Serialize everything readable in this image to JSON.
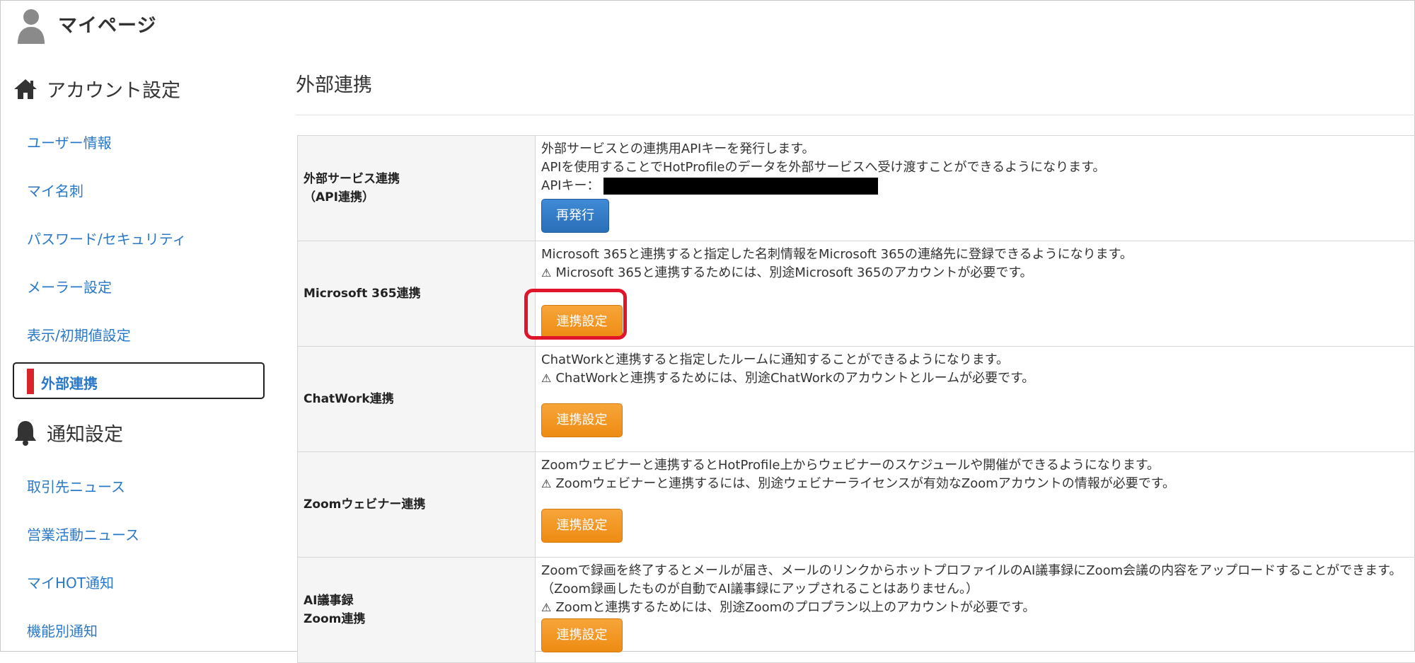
{
  "header": {
    "title": "マイページ",
    "icon": "user-icon"
  },
  "sidebar": {
    "account_section": {
      "label": "アカウント設定",
      "icon": "home-icon"
    },
    "account_items": [
      {
        "label": "ユーザー情報"
      },
      {
        "label": "マイ名刺"
      },
      {
        "label": "パスワード/セキュリティ"
      },
      {
        "label": "メーラー設定"
      },
      {
        "label": "表示/初期値設定"
      },
      {
        "label": "外部連携",
        "active": true
      }
    ],
    "notify_section": {
      "label": "通知設定",
      "icon": "bell-icon"
    },
    "notify_items": [
      {
        "label": "取引先ニュース"
      },
      {
        "label": "営業活動ニュース"
      },
      {
        "label": "マイHOT通知"
      },
      {
        "label": "機能別通知"
      }
    ]
  },
  "main": {
    "title": "外部連携",
    "rows": [
      {
        "label_line1": "外部サービス連携",
        "label_line2": "（API連携）",
        "desc1": "外部サービスとの連携用APIキーを発行します。",
        "desc2": "APIを使用することでHotProfileのデータを外部サービスへ受け渡すことができるようになります。",
        "api_key_label": "APIキー：",
        "button": "再発行"
      },
      {
        "label_line1": "Microsoft 365連携",
        "desc1": "Microsoft 365と連携すると指定した名刺情報をMicrosoft 365の連絡先に登録できるようになります。",
        "warning": "Microsoft 365と連携するためには、別途Microsoft 365のアカウントが必要です。",
        "button": "連携設定"
      },
      {
        "label_line1": "ChatWork連携",
        "desc1": "ChatWorkと連携すると指定したルームに通知することができるようになります。",
        "warning": "ChatWorkと連携するためには、別途ChatWorkのアカウントとルームが必要です。",
        "button": "連携設定"
      },
      {
        "label_line1": "Zoomウェビナー連携",
        "desc1": "Zoomウェビナーと連携するとHotProfile上からウェビナーのスケジュールや開催ができるようになります。",
        "warning": "Zoomウェビナーと連携するには、別途ウェビナーライセンスが有効なZoomアカウントの情報が必要です。",
        "button": "連携設定"
      },
      {
        "label_line1": "AI議事録",
        "label_line2": "Zoom連携",
        "desc1": "Zoomで録画を終了するとメールが届き、メールのリンクからホットプロファイルのAI議事録にZoom会議の内容をアップロードすることができます。",
        "desc2": "（Zoom録画したものが自動でAI議事録にアップされることはありません。）",
        "warning": "Zoomと連携するためには、別途Zoomのプロプラン以上のアカウントが必要です。",
        "button": "連携設定"
      }
    ]
  },
  "colors": {
    "link": "#2a78c8",
    "active_marker": "#d9252a",
    "orange_button": "#ee8b12",
    "blue_button": "#2a6fb8",
    "highlight": "#e0142a"
  }
}
